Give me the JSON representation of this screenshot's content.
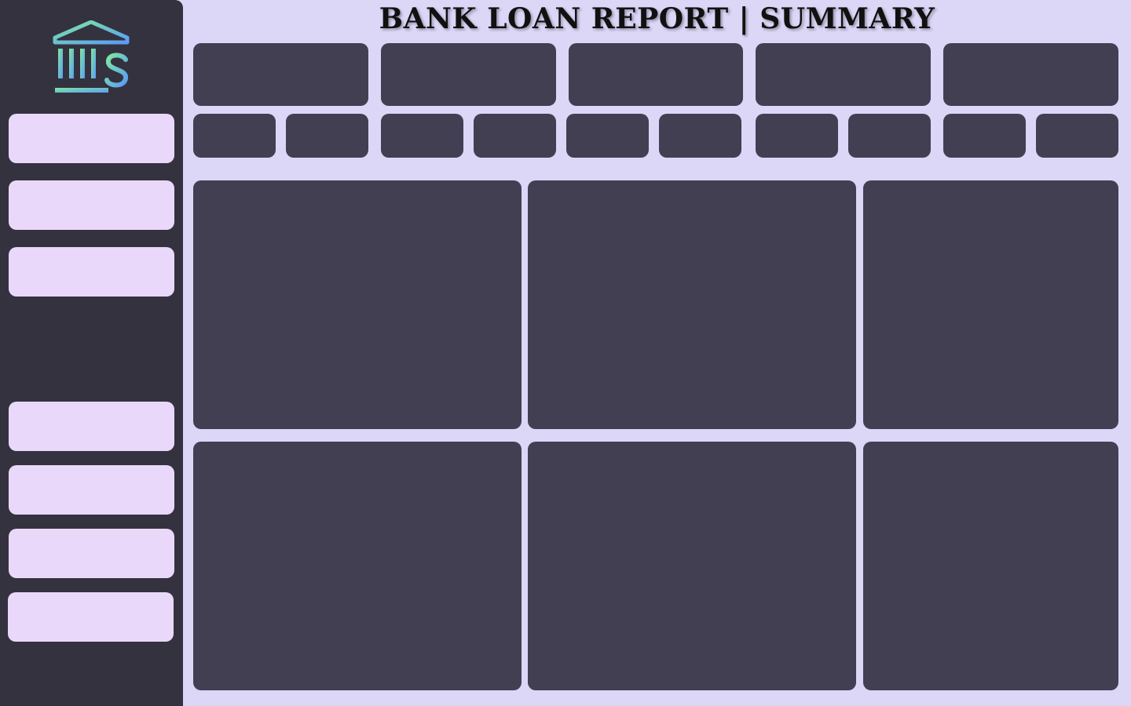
{
  "header": {
    "title": "BANK LOAN REPORT | SUMMARY"
  },
  "sidebar": {
    "logo_icon": "bank-dollar-icon",
    "nav_buttons": [
      {
        "label": ""
      },
      {
        "label": ""
      },
      {
        "label": ""
      },
      {
        "label": ""
      },
      {
        "label": ""
      },
      {
        "label": ""
      },
      {
        "label": ""
      }
    ]
  },
  "colors": {
    "background": "#dcd6f7",
    "sidebar": "#34323f",
    "card": "#423f53",
    "nav_button": "#ead8fb",
    "logo_gradient_start": "#7ee8a0",
    "logo_gradient_end": "#5b9cf6"
  }
}
